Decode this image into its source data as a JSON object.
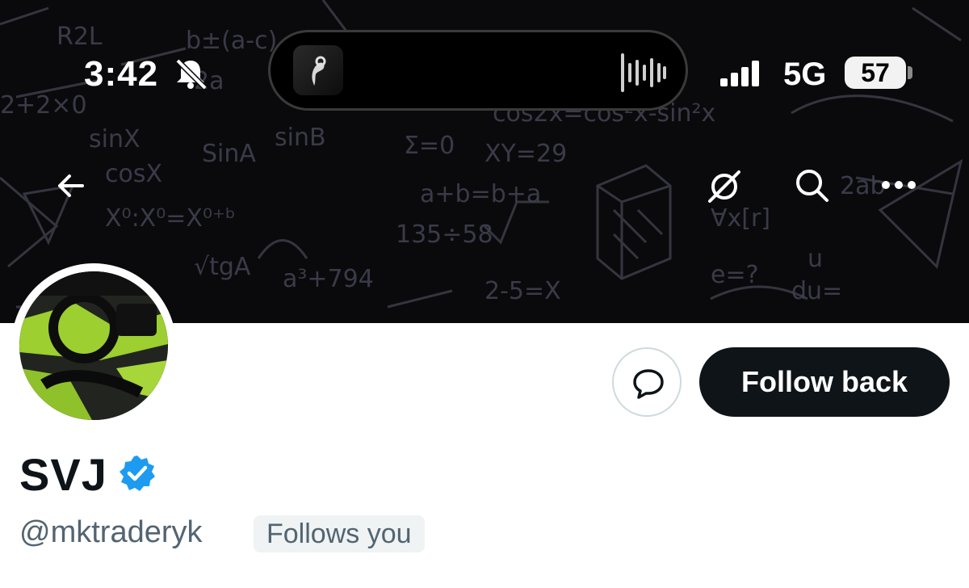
{
  "status_bar": {
    "time": "3:42",
    "network": "5G",
    "battery": "57"
  },
  "profile": {
    "display_name": "SVJ",
    "handle": "@mktraderyk",
    "follows_you_badge": "Follows you"
  },
  "actions": {
    "follow_label": "Follow back"
  },
  "icons": {
    "back": "arrow-left-icon",
    "grok": "grok-icon",
    "search": "search-icon",
    "more": "more-icon",
    "message": "message-icon",
    "verified": "verified-badge-icon",
    "mute": "bell-slash-icon"
  },
  "colors": {
    "follow_button": "#0f1419",
    "verified": "#1d9bf0",
    "handle_text": "#536471",
    "badge_bg": "#eff3f4"
  }
}
